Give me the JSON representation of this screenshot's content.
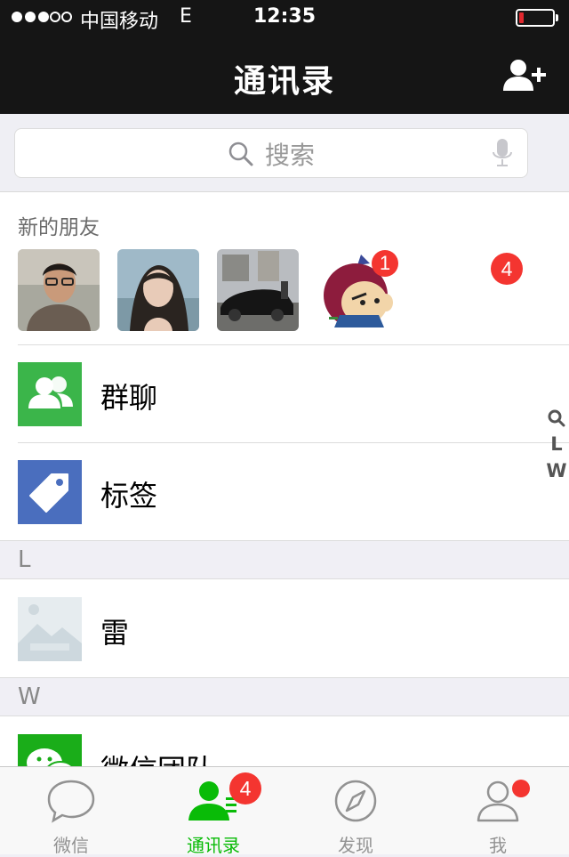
{
  "status_bar": {
    "carrier": "中国移动",
    "network": "E",
    "time": "12:35",
    "signal_strength": 3,
    "signal_max": 5,
    "battery_level": 0.1
  },
  "nav": {
    "title": "通讯录",
    "add_contact_icon": "add-contact-icon"
  },
  "search": {
    "placeholder": "搜索"
  },
  "new_friends": {
    "label": "新的朋友",
    "badge_count": "1",
    "total_badge": "4"
  },
  "items": {
    "group_chat": "群聊",
    "tags": "标签"
  },
  "sections": [
    {
      "letter": "L",
      "contacts": [
        "雷"
      ]
    },
    {
      "letter": "W",
      "contacts": [
        "微信团队"
      ]
    }
  ],
  "index_bar": [
    "L",
    "W"
  ],
  "tabbar": {
    "tabs": [
      {
        "label": "微信"
      },
      {
        "label": "通讯录",
        "badge": "4"
      },
      {
        "label": "发现"
      },
      {
        "label": "我"
      }
    ],
    "active_color": "#09bb07",
    "inactive_color": "#929292"
  },
  "colors": {
    "nav_bg": "#151515",
    "group_icon_bg": "#3bb54a",
    "tag_icon_bg": "#4a6ebe",
    "badge": "#f43530"
  }
}
